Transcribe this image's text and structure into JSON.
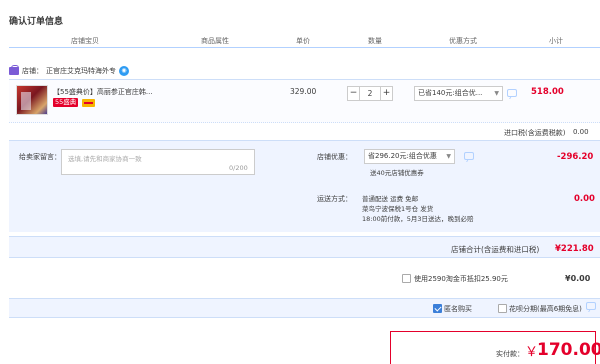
{
  "page": {
    "title": "确认订单信息"
  },
  "columns": [
    "店铺宝贝",
    "商品属性",
    "单价",
    "数量",
    "优惠方式",
    "小计"
  ],
  "shop": {
    "label": "店铺：",
    "name": "正官庄艾克玛特海外专",
    "chat_icon": "wangwang-chat-icon"
  },
  "item": {
    "title": "【55盛典价】高丽参正官庄韩...",
    "badge": "55盛典",
    "unit_price": "329.00",
    "quantity": "2",
    "minus": "−",
    "plus": "+",
    "discount_option": "已省140元:组合优...",
    "subtotal": "518.00"
  },
  "tax_label": "进口税(含运费税款)",
  "tax_amount": "0.00",
  "message": {
    "label": "给卖家留言：",
    "placeholder": "选填,请先和商家协商一致",
    "count": "0/200"
  },
  "coupon": {
    "label": "店铺优惠：",
    "option": "省296.20元:组合优惠",
    "note": "送40元店铺优惠券",
    "amount": "-296.20"
  },
  "shipping": {
    "label": "运送方式：",
    "lines": [
      "普通配送 运费 免邮",
      "菜鸟宁波保税1号仓  发货",
      "18:00前付款，5月3日送达，晚到必赔"
    ],
    "amount": "0.00"
  },
  "shop_total": {
    "label": "店铺合计(含运费和进口税)",
    "value": "¥221.80"
  },
  "taojinbi": {
    "label": "使用2590淘金币抵扣25.90元",
    "amount": "¥0.00",
    "checked": false
  },
  "options": {
    "anonymous": {
      "label": "匿名购买",
      "checked": true
    },
    "huabei": {
      "label": "花呗分期(最高6期免息)",
      "checked": false
    }
  },
  "payment": {
    "label": "实付款：",
    "currency": "￥",
    "amount": "170.00"
  },
  "colors": {
    "accent": "#e4002b",
    "border": "#cddef8",
    "panel": "#eff4ff"
  }
}
